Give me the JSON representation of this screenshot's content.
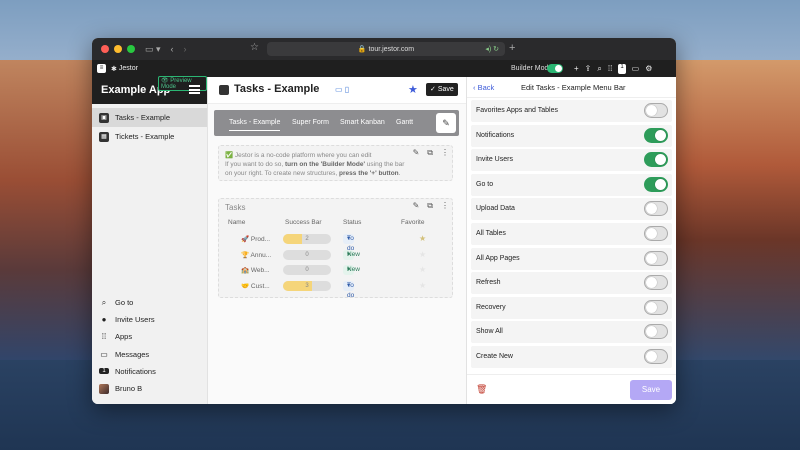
{
  "browser": {
    "url": "tour.jestor.com",
    "new_tab_icon": "plus-icon"
  },
  "appbar": {
    "brand": "Jestor",
    "builder_mode_label": "Builder Mode",
    "builder_mode_on": true,
    "counter_badge": "1"
  },
  "sidebar": {
    "app_title": "Example App",
    "preview_badge": "Preview Mode",
    "items": [
      {
        "label": "Tasks - Example",
        "active": true
      },
      {
        "label": "Tickets - Example",
        "active": false
      }
    ],
    "bottom": [
      {
        "label": "Go to",
        "icon": "search-icon"
      },
      {
        "label": "Invite Users",
        "icon": "user-icon"
      },
      {
        "label": "Apps",
        "icon": "grid-icon"
      },
      {
        "label": "Messages",
        "icon": "chat-icon"
      },
      {
        "label": "Notifications",
        "icon": "bell-icon"
      },
      {
        "label": "Bruno B",
        "icon": "avatar"
      }
    ]
  },
  "page": {
    "title": "Tasks - Example",
    "save_label": "Save",
    "tabs": [
      "Tasks - Example",
      "Super Form",
      "Smart Kanban",
      "Gantt"
    ],
    "info_line1": "Jestor is a no-code platform where you can edit",
    "info_line2_a": "If you want to do so, ",
    "info_line2_b": "turn on the 'Builder Mode'",
    "info_line2_c": " using the bar",
    "info_line3_a": "on your right. To create new structures, ",
    "info_line3_b": "press the '+' button",
    "info_line3_c": ".",
    "info_emoji": "✅"
  },
  "tasks_table": {
    "title": "Tasks",
    "columns": [
      "Name",
      "Success Bar",
      "Status",
      "Favorite"
    ],
    "rows": [
      {
        "name": "🚀 Prod...",
        "success": "2",
        "success_fraction": 0.4,
        "status": "To do",
        "status_kind": "todo",
        "favorite": true
      },
      {
        "name": "🏆 Annu...",
        "success": "0",
        "success_fraction": 0,
        "status": "New",
        "status_kind": "new",
        "favorite": false
      },
      {
        "name": "🏫 Web...",
        "success": "0",
        "success_fraction": 0,
        "status": "New",
        "status_kind": "new",
        "favorite": false
      },
      {
        "name": "🤝 Cust...",
        "success": "3",
        "success_fraction": 0.6,
        "status": "To do",
        "status_kind": "todo",
        "favorite": false
      }
    ]
  },
  "panel": {
    "back_label": "Back",
    "title": "Edit Tasks - Example Menu Bar",
    "options": [
      {
        "label": "Favorites Apps and Tables",
        "on": false
      },
      {
        "label": "Notifications",
        "on": true
      },
      {
        "label": "Invite Users",
        "on": true
      },
      {
        "label": "Go to",
        "on": true
      },
      {
        "label": "Upload Data",
        "on": false
      },
      {
        "label": "All Tables",
        "on": false
      },
      {
        "label": "All App Pages",
        "on": false
      },
      {
        "label": "Refresh",
        "on": false
      },
      {
        "label": "Recovery",
        "on": false
      },
      {
        "label": "Show All",
        "on": false
      },
      {
        "label": "Create New",
        "on": false
      }
    ],
    "save_label": "Save"
  }
}
